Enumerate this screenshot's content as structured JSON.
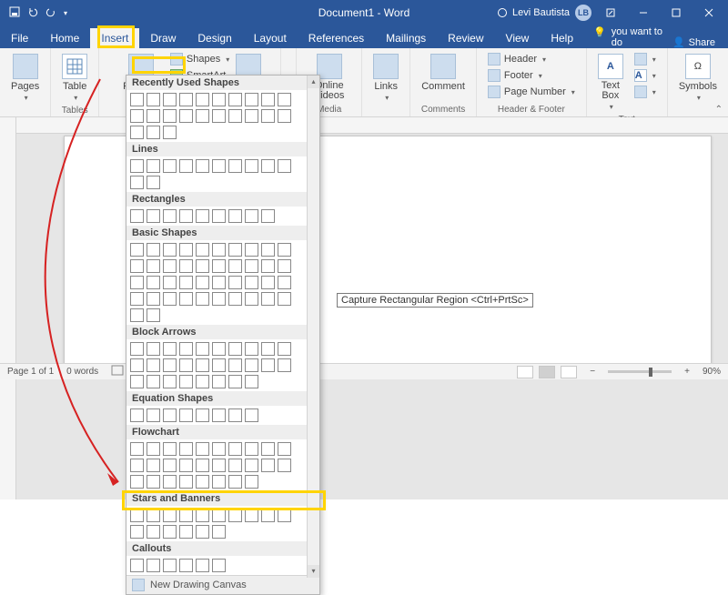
{
  "titlebar": {
    "doc_title": "Document1 - Word",
    "user_name": "Levi Bautista",
    "user_initials": "LB"
  },
  "tabs": {
    "file": "File",
    "home": "Home",
    "insert": "Insert",
    "draw": "Draw",
    "design": "Design",
    "layout": "Layout",
    "references": "References",
    "mailings": "Mailings",
    "review": "Review",
    "view": "View",
    "help": "Help",
    "tell_me": "Tell me what you want to do",
    "share": "Share"
  },
  "ribbon": {
    "pages": {
      "label": "Pages",
      "btn": "Pages"
    },
    "tables": {
      "label": "Tables",
      "btn": "Table"
    },
    "illustrations": {
      "pictures": "Pictures",
      "shapes": "Shapes",
      "smartart": "SmartArt"
    },
    "media": {
      "label": "Media",
      "btn": "Online Videos"
    },
    "links": {
      "label": "",
      "btn": "Links"
    },
    "comments": {
      "label": "Comments",
      "btn": "Comment"
    },
    "header_footer": {
      "label": "Header & Footer",
      "header": "Header",
      "footer": "Footer",
      "page_number": "Page Number"
    },
    "text": {
      "label": "Text",
      "btn": "Text Box"
    },
    "symbols": {
      "label": "Symbols",
      "btn": "Symbols"
    }
  },
  "shapes_dropdown": {
    "categories": [
      "Recently Used Shapes",
      "Lines",
      "Rectangles",
      "Basic Shapes",
      "Block Arrows",
      "Equation Shapes",
      "Flowchart",
      "Stars and Banners",
      "Callouts"
    ],
    "counts": {
      "recently_used": 23,
      "lines": 12,
      "rectangles": 9,
      "basic_shapes": 42,
      "block_arrows": 28,
      "equation_shapes": 8,
      "flowchart": 28,
      "stars_banners": 16,
      "callouts": 6
    },
    "footer": "New Drawing Canvas"
  },
  "document": {
    "tooltip": "Capture Rectangular Region <Ctrl+PrtSc>"
  },
  "statusbar": {
    "page": "Page 1 of 1",
    "words": "0 words",
    "zoom": "90%"
  }
}
